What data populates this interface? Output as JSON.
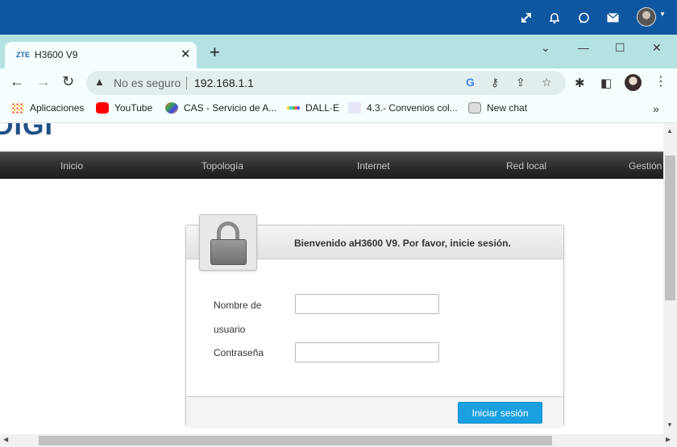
{
  "browser": {
    "tab_title": "H3600 V9",
    "tab_favicon": "ZTE",
    "new_tab": "+",
    "insecure_label": "No es seguro",
    "url": "192.168.1.1"
  },
  "bookmarks": [
    {
      "label": "Aplicaciones"
    },
    {
      "label": "YouTube"
    },
    {
      "label": "CAS - Servicio de A..."
    },
    {
      "label": "DALL·E"
    },
    {
      "label": "4.3.- Convenios col..."
    },
    {
      "label": "New chat"
    }
  ],
  "page": {
    "logo": "DIGI",
    "nav": [
      "Inicio",
      "Topología",
      "Internet",
      "Red local",
      "Gestión"
    ],
    "login": {
      "title": "Bienvenido aH3600 V9. Por favor, inicie sesión.",
      "username_label_line1": "Nombre de",
      "username_label_line2": "usuario",
      "password_label": "Contraseña",
      "username_value": "",
      "password_value": "",
      "submit_label": "Iniciar sesión"
    }
  },
  "colors": {
    "top_bar": "#0e56a0",
    "tab_strip": "#b4e2e2",
    "login_button": "#1aa0e0"
  }
}
